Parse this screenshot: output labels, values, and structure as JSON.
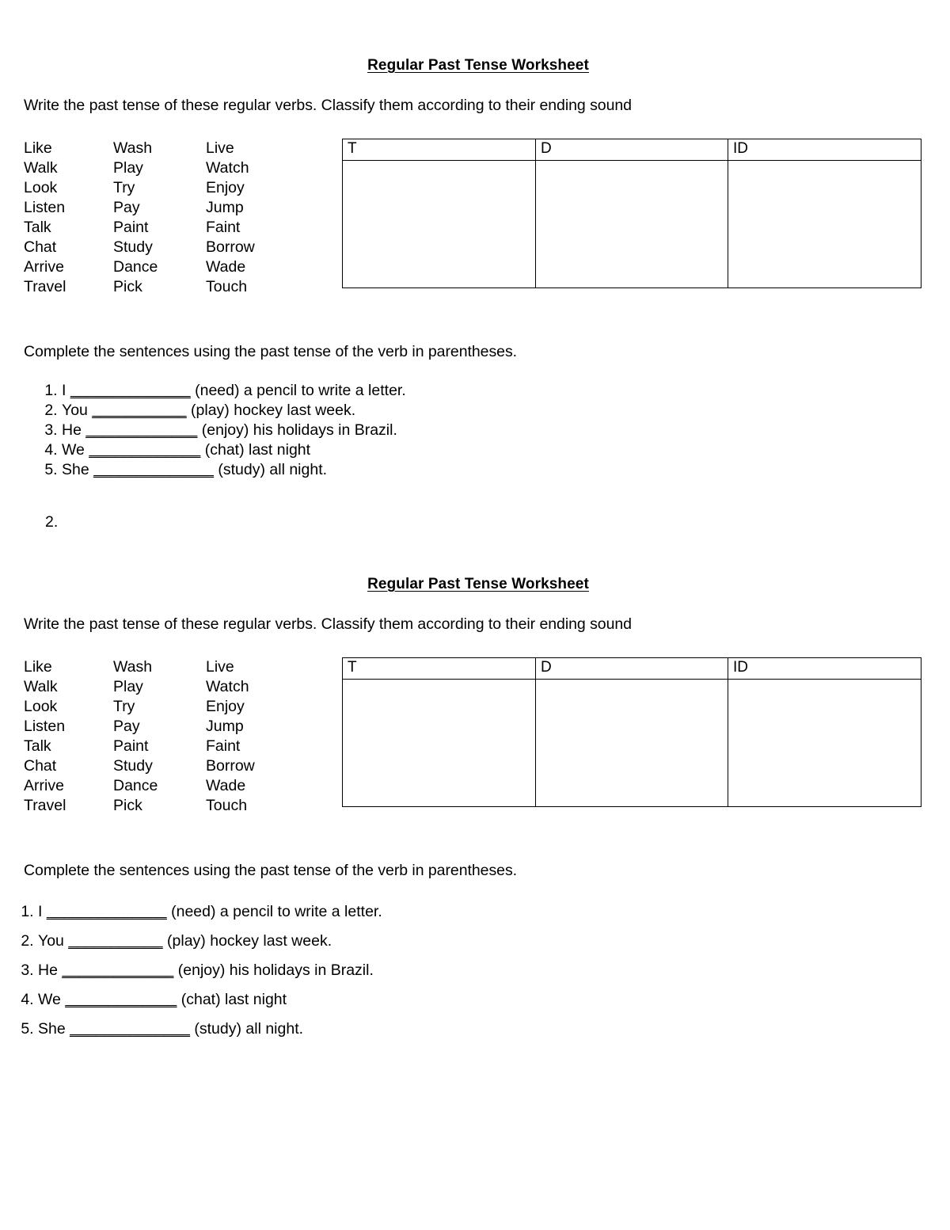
{
  "document": {
    "title": "Regular Past Tense Worksheet"
  },
  "worksheet": {
    "title": "Regular Past Tense Worksheet",
    "instruction_verbs": "Write the past tense of these regular verbs. Classify them according to their ending sound",
    "instruction_sentences": "Complete the sentences using the past tense of the verb in parentheses.",
    "verb_columns": [
      [
        "Like",
        "Walk",
        "Look",
        "Listen",
        "Talk",
        "Chat",
        "Arrive",
        "Travel"
      ],
      [
        "Wash",
        "Play",
        "Try",
        "Pay",
        "Paint",
        "Study",
        "Dance",
        "Pick"
      ],
      [
        "Live",
        "Watch",
        "Enjoy",
        "Jump",
        "Faint",
        "Borrow",
        "Wade",
        "Touch"
      ]
    ],
    "table": {
      "headers": [
        "T",
        "D",
        "ID"
      ],
      "rows": [
        [
          "",
          "",
          ""
        ]
      ]
    },
    "sentences": [
      {
        "before": "I ",
        "blank": "______________",
        "after": " (need) a pencil to write a letter."
      },
      {
        "before": "You ",
        "blank": "___________",
        "after": " (play) hockey last week."
      },
      {
        "before": "He ",
        "blank": "_____________",
        "after": " (enjoy) his holidays in Brazil."
      },
      {
        "before": "We ",
        "blank": "_____________",
        "after": " (chat) last night"
      },
      {
        "before": "She ",
        "blank": "______________",
        "after": " (study) all night."
      }
    ]
  },
  "outer_list_marker": "2."
}
